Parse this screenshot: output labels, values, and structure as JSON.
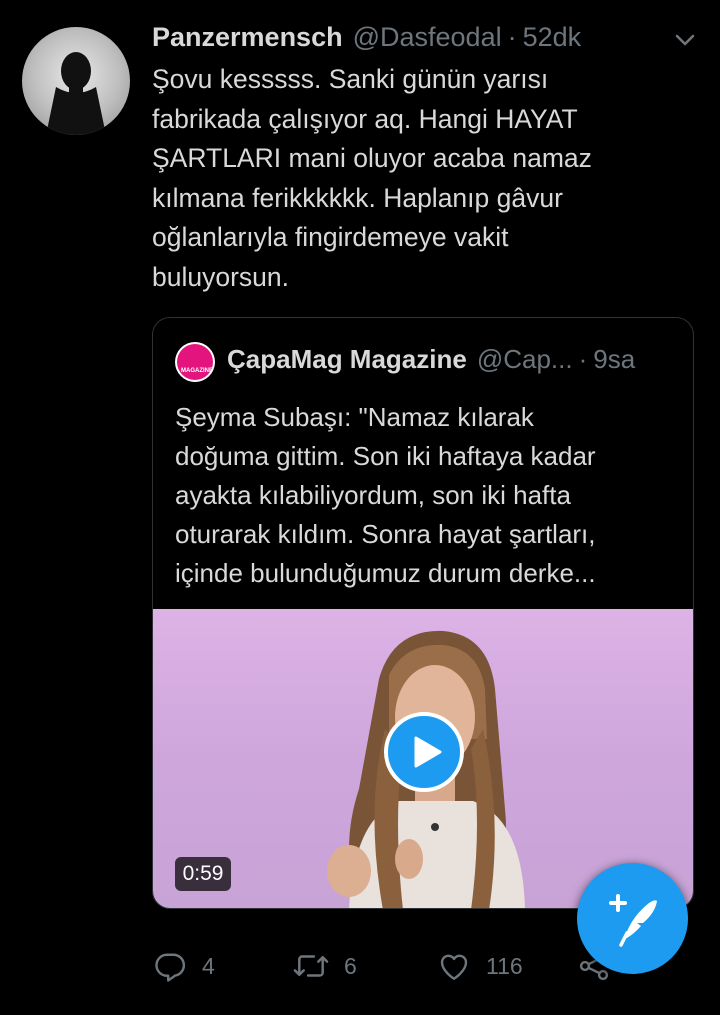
{
  "tweet": {
    "display_name": "Panzermensch",
    "handle": "@Dasfeodal",
    "separator": "·",
    "time": "52dk",
    "text": "Şovu kesssss. Sanki günün yarısı\nfabrikada çalışıyor aq. Hangi HAYAT\nŞARTLARI mani oluyor acaba namaz\nkılmana ferikkkkkk. Haplanıp gâvur\noğlanlarıyla fingirdemeye vakit\nbuluyorsun."
  },
  "quoted_tweet": {
    "display_name": "ÇapaMag Magazine",
    "handle": "@Cap...",
    "separator": "·",
    "time": "9sa",
    "text": "Şeyma Subaşı: \"Namaz kılarak\ndoğuma gittim. Son iki haftaya kadar\nayakta kılabiliyordum, son iki hafta\noturarak kıldım. Sonra hayat şartları,\niçinde bulunduğumuz durum derke...",
    "avatar_logo_text": "MAGAZINE",
    "video": {
      "duration": "0:59"
    }
  },
  "actions": {
    "reply_count": "4",
    "retweet_count": "6",
    "like_count": "116"
  },
  "icons": {
    "menu": "chevron-down-icon",
    "play": "play-icon",
    "reply": "reply-icon",
    "retweet": "retweet-icon",
    "like": "heart-icon",
    "share": "share-icon",
    "compose": "compose-tweet-icon"
  },
  "colors": {
    "background": "#000000",
    "accent": "#1d9bf0",
    "secondary_text": "#6e767d",
    "primary_text": "#d9d9d9",
    "brand_pink": "#e4147f"
  }
}
